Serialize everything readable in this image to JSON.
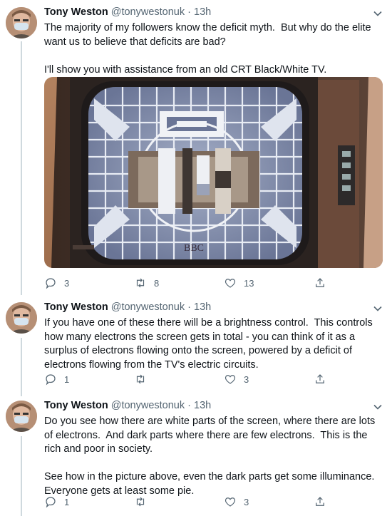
{
  "tweets": [
    {
      "name": "Tony Weston",
      "handle": "@tonywestonuk",
      "dot": "·",
      "time": "13h",
      "text": "The majority of my followers know the deficit myth.  But why do the elite want us to believe that deficits are bad?\n\nI'll show you with assistance from an old CRT Black/White TV.",
      "counts": {
        "reply": "3",
        "retweet": "8",
        "like": "13"
      }
    },
    {
      "name": "Tony Weston",
      "handle": "@tonywestonuk",
      "dot": "·",
      "time": "13h",
      "text": "If you have one of these there will be a brightness control.  This controls how many electrons the screen gets in total - you can think of it as a surplus of electrons flowing onto the screen, powered by a deficit of electrons flowing from the TV's electric circuits.",
      "counts": {
        "reply": "1",
        "retweet": "",
        "like": "3"
      }
    },
    {
      "name": "Tony Weston",
      "handle": "@tonywestonuk",
      "dot": "·",
      "time": "13h",
      "text": "Do you see how there are white parts of the screen, where there are lots of electrons.  And dark parts where there are few electrons.  This is the rich and poor in society.\n\nSee how in the picture above, even the dark parts get some illuminance.  Everyone gets at least some pie.",
      "counts": {
        "reply": "1",
        "retweet": "",
        "like": "3"
      }
    }
  ],
  "media": {
    "tv_logo": "BBC"
  },
  "colors": {
    "text": "#0f1419",
    "secondary": "#536471",
    "line": "#cfd9de"
  }
}
